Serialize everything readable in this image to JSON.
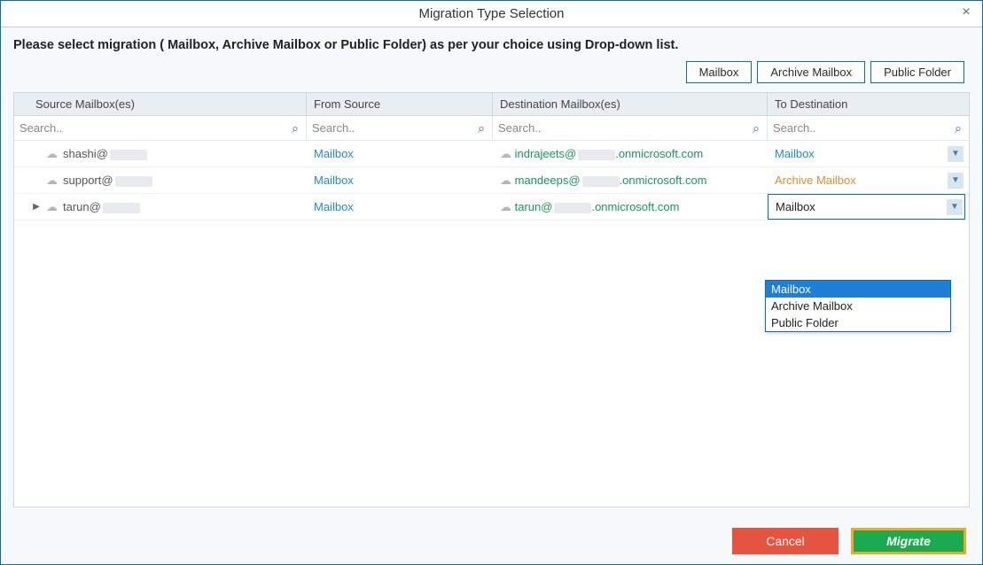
{
  "title": "Migration Type Selection",
  "instruction": "Please select migration ( Mailbox, Archive Mailbox or Public Folder) as per your choice using Drop-down list.",
  "type_buttons": {
    "mailbox": "Mailbox",
    "archive": "Archive Mailbox",
    "public": "Public Folder"
  },
  "columns": {
    "source": "Source Mailbox(es)",
    "from": "From Source",
    "dest": "Destination Mailbox(es)",
    "to": "To Destination"
  },
  "search": {
    "placeholder": "Search.."
  },
  "rows": [
    {
      "expandable": false,
      "source_prefix": "shashi@",
      "from": "Mailbox",
      "dest_prefix": "indrajeets@",
      "dest_suffix": ".onmicrosoft.com",
      "to": "Mailbox",
      "to_color": "link",
      "open": false
    },
    {
      "expandable": false,
      "source_prefix": "support@",
      "from": "Mailbox",
      "dest_prefix": "mandeeps@",
      "dest_suffix": ".onmicrosoft.com",
      "to": "Archive Mailbox",
      "to_color": "orange",
      "open": false
    },
    {
      "expandable": true,
      "source_prefix": "tarun@",
      "from": "Mailbox",
      "dest_prefix": "tarun@",
      "dest_suffix": ".onmicrosoft.com",
      "to": "Mailbox",
      "to_color": "plain",
      "open": true
    }
  ],
  "dropdown": {
    "options": [
      "Mailbox",
      "Archive Mailbox",
      "Public Folder"
    ],
    "selected": "Mailbox"
  },
  "footer": {
    "cancel": "Cancel",
    "migrate": "Migrate"
  }
}
